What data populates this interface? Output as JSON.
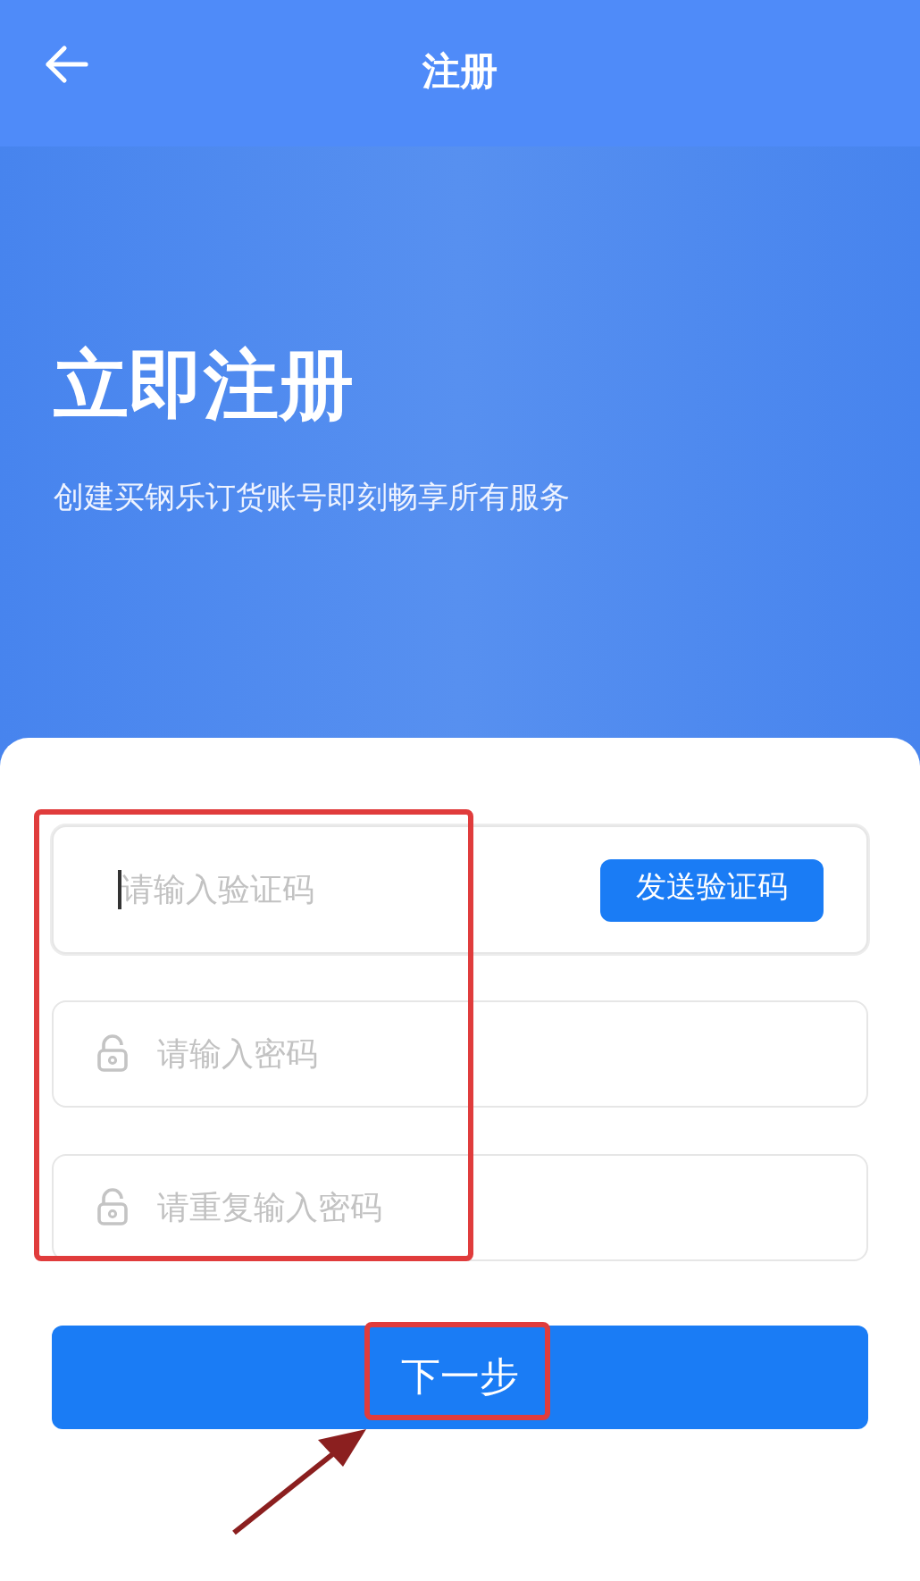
{
  "header": {
    "title": "注册"
  },
  "hero": {
    "title": "立即注册",
    "subtitle": "创建买钢乐订货账号即刻畅享所有服务"
  },
  "fields": [
    {
      "kind": "code",
      "placeholder": "请输入验证码",
      "focused": true,
      "action": "发送验证码"
    },
    {
      "kind": "password",
      "placeholder": "请输入密码",
      "focused": false
    },
    {
      "kind": "password",
      "placeholder": "请重复输入密码",
      "focused": false
    }
  ],
  "next_button": "下一步"
}
